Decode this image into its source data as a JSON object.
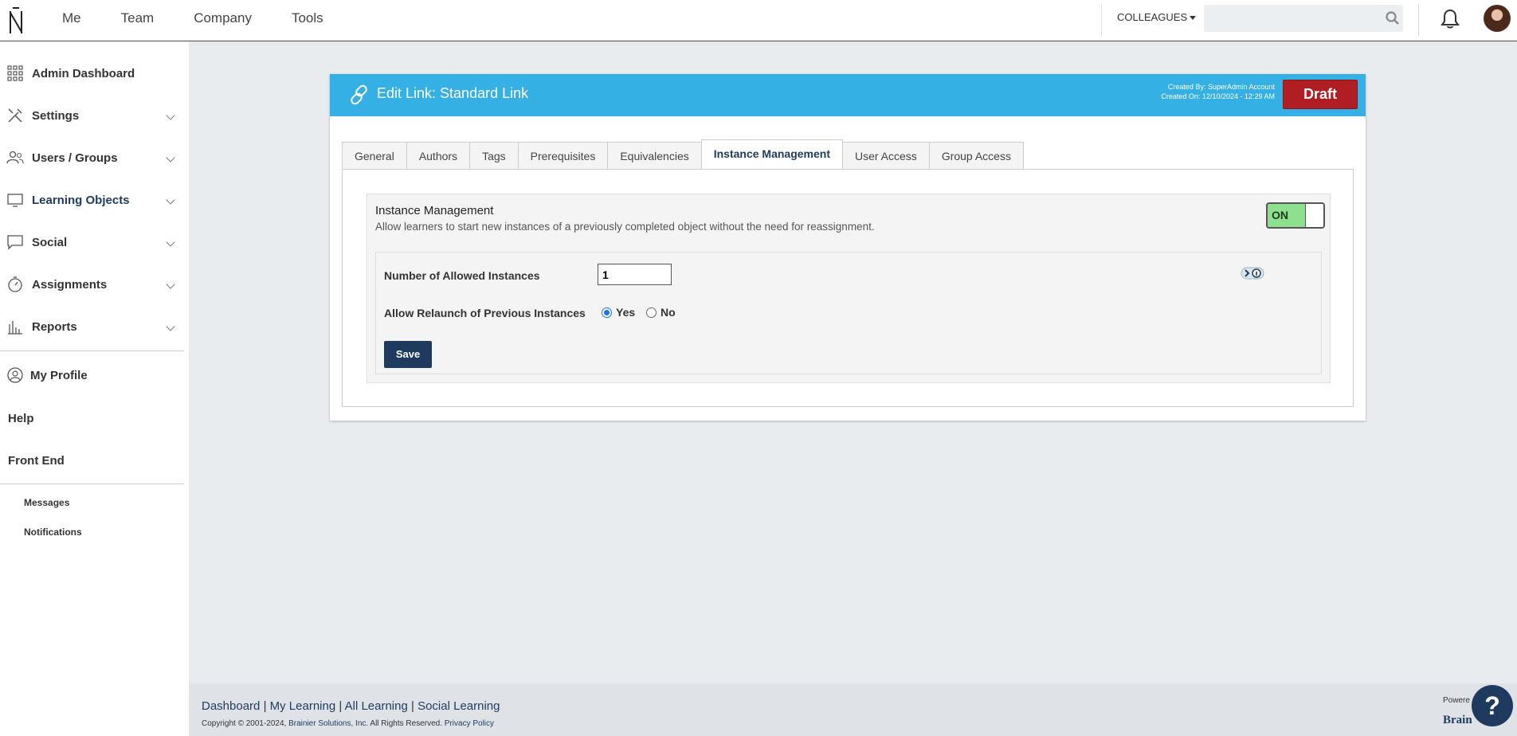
{
  "topnav": {
    "items": [
      "Me",
      "Team",
      "Company",
      "Tools"
    ]
  },
  "header": {
    "colleagues_label": "COLLEAGUES",
    "search_placeholder": ""
  },
  "sidebar": {
    "items": [
      {
        "label": "Admin Dashboard",
        "icon": "grid-icon"
      },
      {
        "label": "Settings",
        "icon": "tools-icon"
      },
      {
        "label": "Users / Groups",
        "icon": "users-icon"
      },
      {
        "label": "Learning Objects",
        "icon": "monitor-icon"
      },
      {
        "label": "Social",
        "icon": "chat-icon"
      },
      {
        "label": "Assignments",
        "icon": "stopwatch-icon"
      },
      {
        "label": "Reports",
        "icon": "bar-chart-icon"
      }
    ],
    "my_profile": "My Profile",
    "help": "Help",
    "front_end": "Front End",
    "messages": "Messages",
    "notifications": "Notifications"
  },
  "panel": {
    "title": "Edit Link: Standard Link",
    "created_by": "Created By: SuperAdmin Account",
    "created_on": "Created On: 12/10/2024 - 12:29 AM",
    "status": "Draft",
    "tabs": [
      "General",
      "Authors",
      "Tags",
      "Prerequisites",
      "Equivalencies",
      "Instance Management",
      "User Access",
      "Group Access"
    ],
    "active_tab": "Instance Management"
  },
  "instance_management": {
    "title": "Instance Management",
    "description": "Allow learners to start new instances of a previously completed object without the need for reassignment.",
    "toggle_label": "ON",
    "allowed_instances_label": "Number of Allowed Instances",
    "allowed_instances_value": "1",
    "relaunch_label": "Allow Relaunch of Previous Instances",
    "relaunch_yes": "Yes",
    "relaunch_no": "No",
    "relaunch_selected": "Yes",
    "save_label": "Save"
  },
  "footer": {
    "links": [
      "Dashboard",
      "My Learning",
      "All Learning",
      "Social Learning"
    ],
    "copyright_prefix": "Copyright © 2001-2024, ",
    "company": "Brainier Solutions, Inc.",
    "rights": " All Rights Reserved. ",
    "privacy": "Privacy Policy",
    "powered_by": "Powere",
    "brand": "Brain"
  },
  "help_button": "?",
  "colors": {
    "header_blue": "#35b0e4",
    "navy": "#1e3a5f",
    "draft_red": "#b01e23",
    "toggle_green": "#8de08d"
  }
}
